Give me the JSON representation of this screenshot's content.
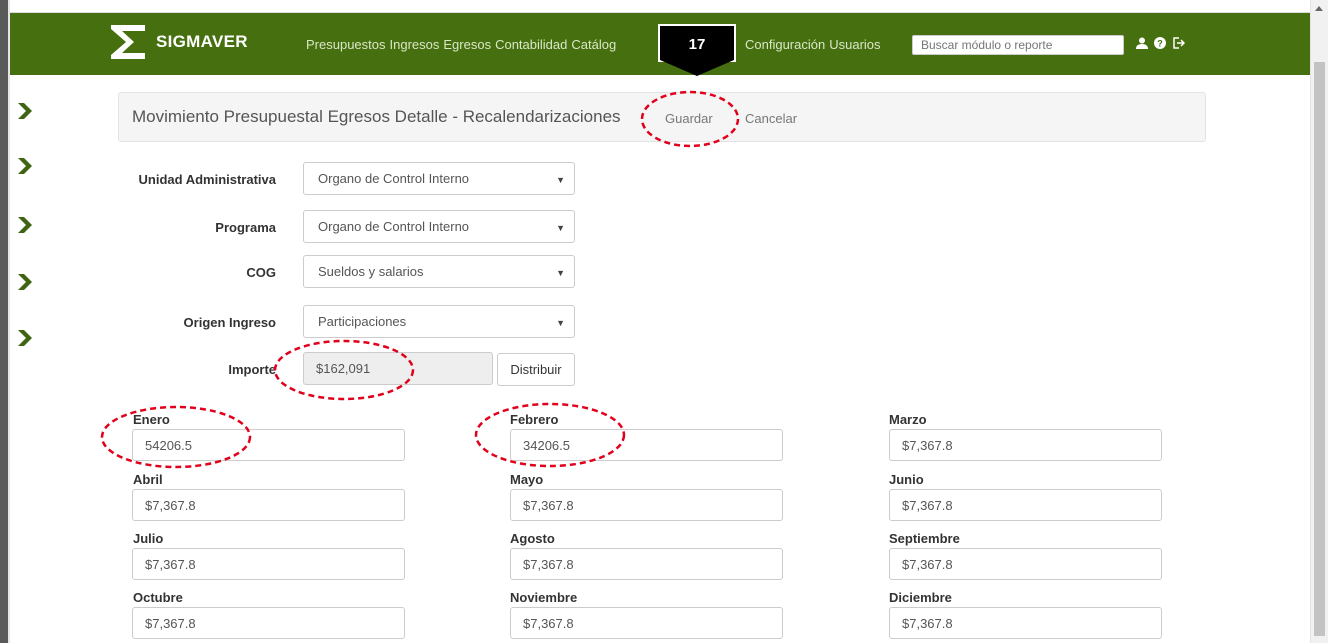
{
  "nav": {
    "brand": "SIGMAVER",
    "menu": [
      "Presupuestos",
      "Ingresos",
      "Egresos",
      "Contabilidad",
      "Catálog"
    ],
    "menu_right": [
      "Configuración",
      "Usuarios"
    ],
    "search_placeholder": "Buscar módulo o reporte",
    "icons": [
      "user-icon",
      "help-icon",
      "logout-icon"
    ],
    "step_badge": "17",
    "bar_color": "#46700f"
  },
  "panel": {
    "title": "Movimiento Presupuestal Egresos Detalle - Recalendarizaciones",
    "save_label": "Guardar",
    "cancel_label": "Cancelar"
  },
  "form": {
    "unidad_label": "Unidad Administrativa",
    "unidad_value": "Organo de Control Interno",
    "programa_label": "Programa",
    "programa_value": "Organo de Control Interno",
    "cog_label": "COG",
    "cog_value": "Sueldos y salarios",
    "origen_label": "Origen Ingreso",
    "origen_value": "Participaciones",
    "importe_label": "Importe",
    "importe_value": "$162,091",
    "distribuir_label": "Distribuir"
  },
  "months": [
    {
      "label": "Enero",
      "value": "54206.5"
    },
    {
      "label": "Febrero",
      "value": "34206.5"
    },
    {
      "label": "Marzo",
      "value": "$7,367.8"
    },
    {
      "label": "Abril",
      "value": "$7,367.8"
    },
    {
      "label": "Mayo",
      "value": "$7,367.8"
    },
    {
      "label": "Junio",
      "value": "$7,367.8"
    },
    {
      "label": "Julio",
      "value": "$7,367.8"
    },
    {
      "label": "Agosto",
      "value": "$7,367.8"
    },
    {
      "label": "Septiembre",
      "value": "$7,367.8"
    },
    {
      "label": "Octubre",
      "value": "$7,367.8"
    },
    {
      "label": "Noviembre",
      "value": "$7,367.8"
    },
    {
      "label": "Diciembre",
      "value": "$7,367.8"
    }
  ],
  "annotation_color": "#e0001b"
}
